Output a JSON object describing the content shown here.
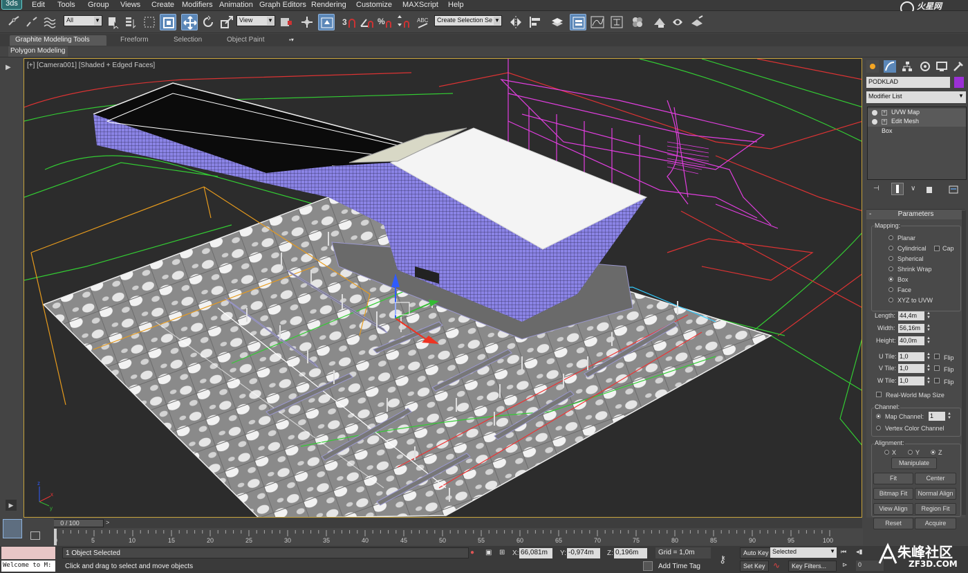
{
  "app": {
    "logo_label": "3ds"
  },
  "menu": [
    "Edit",
    "Tools",
    "Group",
    "Views",
    "Create",
    "Modifiers",
    "Animation",
    "Graph Editors",
    "Rendering",
    "Customize",
    "MAXScript",
    "Help"
  ],
  "toolbar": {
    "filter_value": "All",
    "refcoord_value": "View",
    "selection_set_placeholder": "Create Selection Se"
  },
  "ribbon": {
    "tabs": [
      "Graphite Modeling Tools",
      "Freeform",
      "Selection",
      "Object Paint"
    ],
    "subpanel": "Polygon Modeling"
  },
  "viewport": {
    "label": "[+] [Camera001] [Shaded + Edged Faces]",
    "gizmo_axes": [
      "x",
      "y",
      "z"
    ]
  },
  "command_panel": {
    "object_name": "PODKLAD",
    "object_color": "#9b30d6",
    "modifier_list": "Modifier List",
    "stack": [
      "UVW Map",
      "Edit Mesh",
      "Box"
    ],
    "parameters_title": "Parameters",
    "mapping": {
      "title": "Mapping:",
      "options": [
        "Planar",
        "Cylindrical",
        "Spherical",
        "Shrink Wrap",
        "Box",
        "Face",
        "XYZ to UVW"
      ],
      "selected": "Box",
      "cap_label": "Cap"
    },
    "length_label": "Length:",
    "length": "44,4m",
    "width_label": "Width:",
    "width": "56,16m",
    "height_label": "Height:",
    "height": "40,0m",
    "utile_label": "U Tile:",
    "utile": "1,0",
    "vtile_label": "V Tile:",
    "vtile": "1,0",
    "wtile_label": "W Tile:",
    "wtile": "1,0",
    "flip_label": "Flip",
    "real_world": "Real-World Map Size",
    "channel": {
      "title": "Channel:",
      "map_channel_label": "Map Channel:",
      "map_channel": "1",
      "vertex_color": "Vertex Color Channel"
    },
    "alignment": {
      "title": "Alignment:",
      "axes": [
        "X",
        "Y",
        "Z"
      ],
      "selected": "Z"
    },
    "buttons": [
      "Manipulate",
      "Fit",
      "Center",
      "Bitmap Fit",
      "Normal Align",
      "View Align",
      "Region Fit",
      "Reset",
      "Acquire"
    ]
  },
  "timeline": {
    "slider": "0 / 100",
    "ticks": [
      "0",
      "5",
      "10",
      "15",
      "20",
      "25",
      "30",
      "35",
      "40",
      "45",
      "50",
      "55",
      "60",
      "65",
      "70",
      "75",
      "80",
      "85",
      "90",
      "95",
      "100"
    ]
  },
  "status": {
    "welcome": "Welcome to M:",
    "selection_info": "1 Object Selected",
    "hint": "Click and drag to select and move objects",
    "x_label": "X:",
    "x": "66,081m",
    "y_label": "Y:",
    "y": "-0,974m",
    "z_label": "Z:",
    "z": "0,196m",
    "grid": "Grid = 1,0m",
    "add_time_tag": "Add Time Tag",
    "auto_key": "Auto Key",
    "set_key": "Set Key",
    "key_mode": "Selected",
    "key_filters": "Key Filters...",
    "frame": "0"
  },
  "watermarks": {
    "top": "火星网 hxsd.com",
    "bottom_cn": "朱峰社区",
    "bottom_en": "ZF3D.COM"
  }
}
